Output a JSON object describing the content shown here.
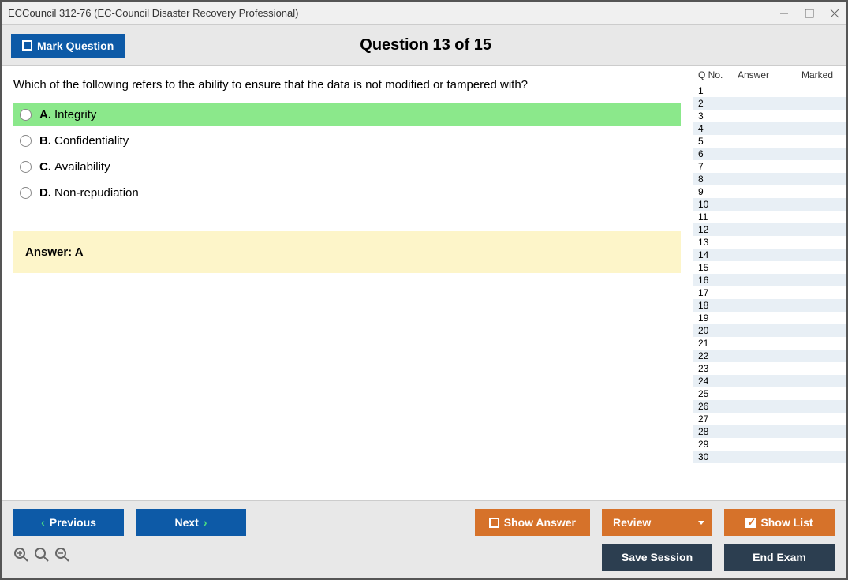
{
  "window": {
    "title": "ECCouncil 312-76 (EC-Council Disaster Recovery Professional)"
  },
  "header": {
    "mark_label": "Mark Question",
    "question_title": "Question 13 of 15"
  },
  "question": {
    "text": "Which of the following refers to the ability to ensure that the data is not modified or tampered with?",
    "options": [
      {
        "letter": "A.",
        "text": "Integrity",
        "selected": true
      },
      {
        "letter": "B.",
        "text": "Confidentiality",
        "selected": false
      },
      {
        "letter": "C.",
        "text": "Availability",
        "selected": false
      },
      {
        "letter": "D.",
        "text": "Non-repudiation",
        "selected": false
      }
    ],
    "answer_label": "Answer: A"
  },
  "sidebar": {
    "col_qno": "Q No.",
    "col_answer": "Answer",
    "col_marked": "Marked",
    "rows": [
      1,
      2,
      3,
      4,
      5,
      6,
      7,
      8,
      9,
      10,
      11,
      12,
      13,
      14,
      15,
      16,
      17,
      18,
      19,
      20,
      21,
      22,
      23,
      24,
      25,
      26,
      27,
      28,
      29,
      30
    ]
  },
  "footer": {
    "previous": "Previous",
    "next": "Next",
    "show_answer": "Show Answer",
    "review": "Review",
    "show_list": "Show List",
    "save_session": "Save Session",
    "end_exam": "End Exam"
  }
}
